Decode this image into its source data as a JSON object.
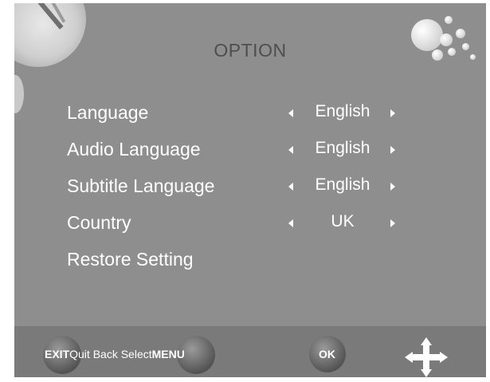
{
  "title": "OPTION",
  "menu": {
    "items": [
      {
        "label": "Language",
        "value": "English"
      },
      {
        "label": "Audio Language",
        "value": "English"
      },
      {
        "label": "Subtitle Language",
        "value": "English"
      },
      {
        "label": "Country",
        "value": "UK"
      },
      {
        "label": "Restore Setting"
      }
    ]
  },
  "footer": {
    "exit_label": "EXIT",
    "hint_text": "Quit Back Select",
    "menu_label": "MENU",
    "ok_label": "OK",
    "dpad_icon": "dpad-arrows-icon"
  },
  "colors": {
    "panel": "#8e8e8e",
    "bottom_bar": "#7a7a7a",
    "title": "#4e4e4e",
    "text": "#ffffff"
  }
}
